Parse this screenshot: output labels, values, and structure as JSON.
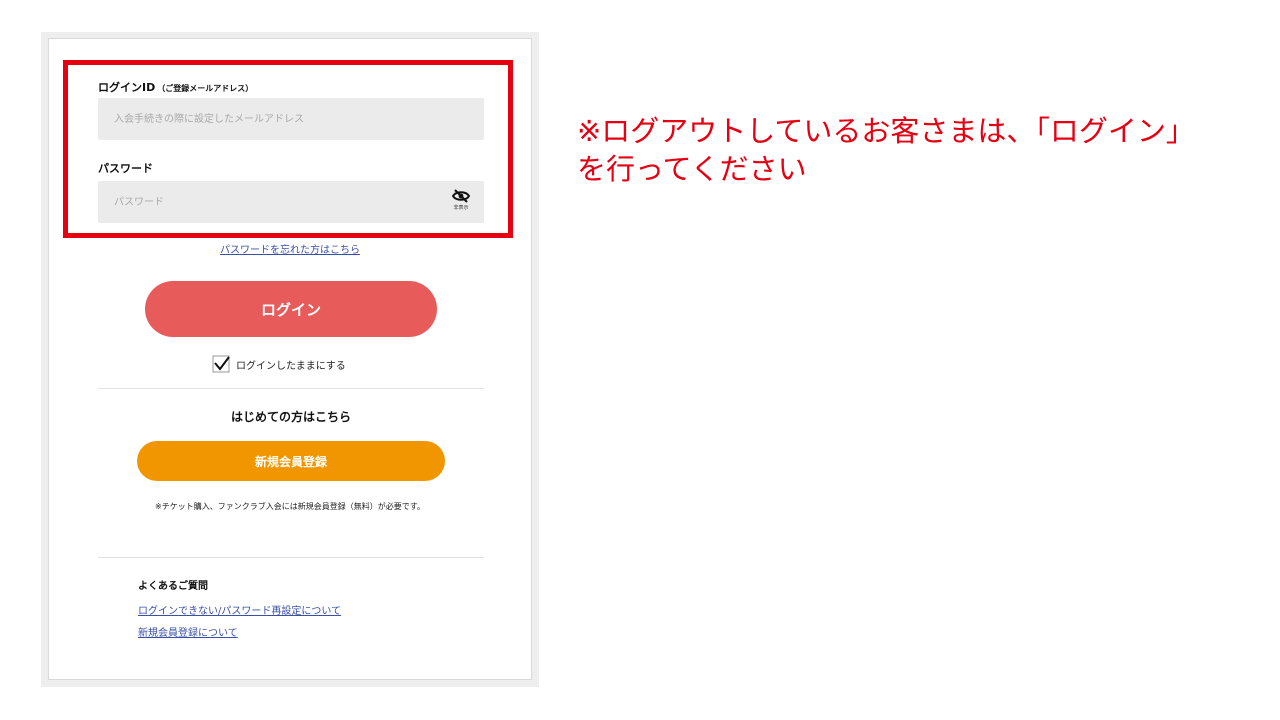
{
  "login_form": {
    "id_label": "ログインID",
    "id_sub_label": "（ご登録メールアドレス）",
    "id_placeholder": "入会手続きの際に設定したメールアドレス",
    "password_label": "パスワード",
    "password_placeholder": "パスワード",
    "password_toggle_label": "非表示",
    "password_toggle_icon": "eye-slash-icon",
    "forgot_link": "パスワードを忘れた方はこちら",
    "login_button": "ログイン",
    "remember_me_label": "ログインしたままにする",
    "remember_me_checked": true
  },
  "registration": {
    "heading": "はじめての方はこちら",
    "register_button": "新規会員登録",
    "note": "※チケット購入、ファンクラブ入会には新規会員登録（無料）が必要です。"
  },
  "faq": {
    "title": "よくあるご質問",
    "links": [
      "ログインできない/パスワード再設定について",
      "新規会員登録について"
    ]
  },
  "annotation": {
    "line1": "※ログアウトしているお客さまは、「ログイン」",
    "line2": "を行ってください"
  },
  "colors": {
    "highlight": "#e50012",
    "login_button": "#e85b5b",
    "register_button": "#f29600",
    "link": "#3b4fa8"
  }
}
